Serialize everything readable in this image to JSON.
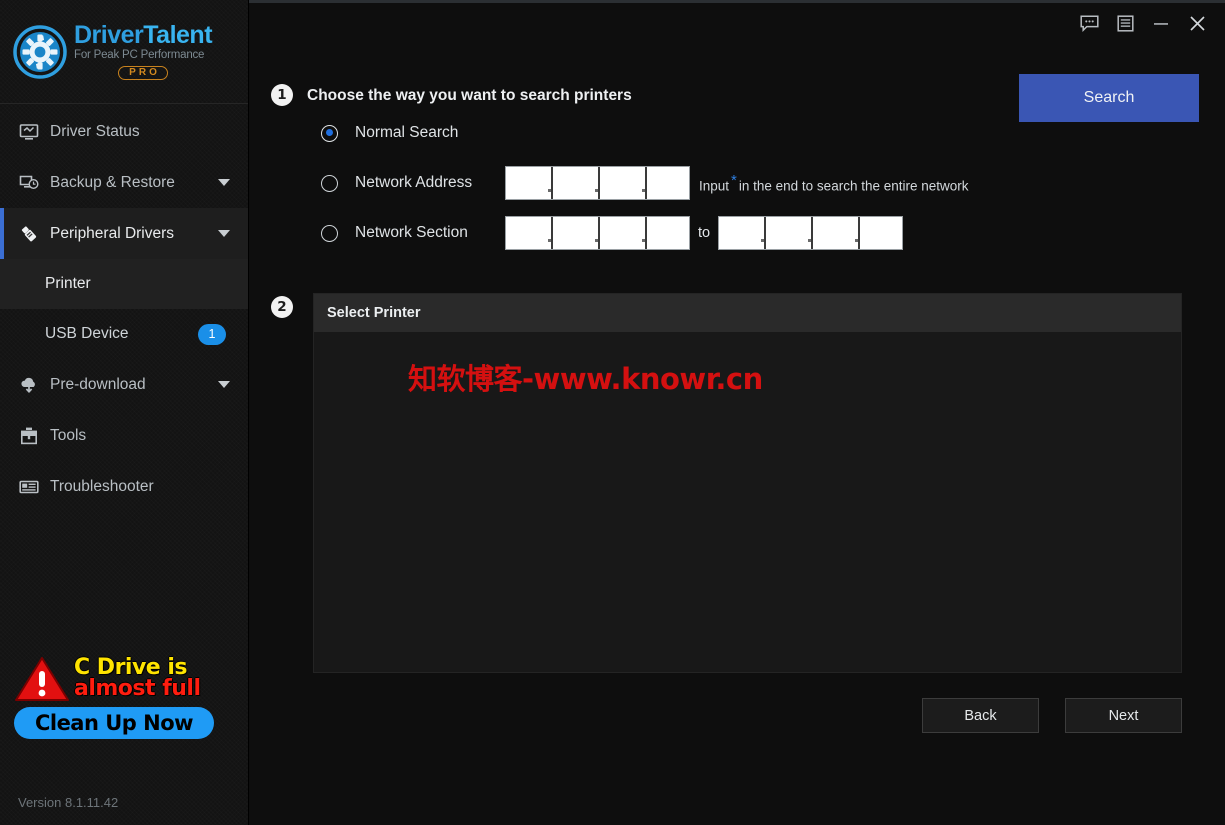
{
  "app": {
    "brand_line1_a": "Driver",
    "brand_line1_b": "Talent",
    "brand_tagline": "For Peak PC Performance",
    "brand_badge": "PRO",
    "version": "Version 8.1.11.42",
    "accent_blue": "#3b6fd4",
    "logo_blue": "#39b4f0",
    "badge_blue": "#1a8fe8"
  },
  "titlebar": {
    "feedback_icon": "chat-bubble-icon",
    "menu_icon": "list-menu-icon",
    "minimize_icon": "minimize-icon",
    "close_icon": "close-icon"
  },
  "sidebar": {
    "items": [
      {
        "label": "Driver Status",
        "icon": "monitor-icon",
        "caret": false,
        "active": false
      },
      {
        "label": "Backup & Restore",
        "icon": "backup-clock-icon",
        "caret": true,
        "active": false
      },
      {
        "label": "Peripheral Drivers",
        "icon": "usb-stick-icon",
        "caret": true,
        "active": true
      },
      {
        "label": "Pre-download",
        "icon": "cloud-download-icon",
        "caret": true,
        "active": false
      },
      {
        "label": "Tools",
        "icon": "toolbox-icon",
        "caret": false,
        "active": false
      },
      {
        "label": "Troubleshooter",
        "icon": "troubleshoot-icon",
        "caret": false,
        "active": false
      }
    ],
    "subitems": [
      {
        "label": "Printer",
        "badge": "",
        "selected": true
      },
      {
        "label": "USB Device",
        "badge": "1",
        "selected": false
      }
    ]
  },
  "ad": {
    "line1": "C Drive is",
    "line2": "almost full",
    "button": "Clean Up Now",
    "line1_color": "#ffe400",
    "line2_color": "#ff1d0f",
    "button_color": "#1f9bf5"
  },
  "main": {
    "step1_number": "1",
    "step2_number": "2",
    "section_title": "Choose the way you want to search printers",
    "search_button": "Search",
    "search_button_color": "#3a56b4",
    "options": [
      {
        "label": "Normal Search",
        "selected": true
      },
      {
        "label": "Network Address",
        "selected": false
      },
      {
        "label": "Network Section",
        "selected": false
      }
    ],
    "network_address": {
      "octets": [
        "",
        "",
        "",
        ""
      ]
    },
    "network_section": {
      "from_octets": [
        "",
        "",
        "",
        ""
      ],
      "to_octets": [
        "",
        "",
        "",
        ""
      ],
      "to_label": "to"
    },
    "hint_prefix": "Input",
    "hint_star": "*",
    "hint_suffix": "in the end to search the entire network",
    "panel_title": "Select Printer",
    "watermark": "知软博客-www.knowr.cn",
    "watermark_color": "#d41010",
    "back_button": "Back",
    "next_button": "Next"
  }
}
